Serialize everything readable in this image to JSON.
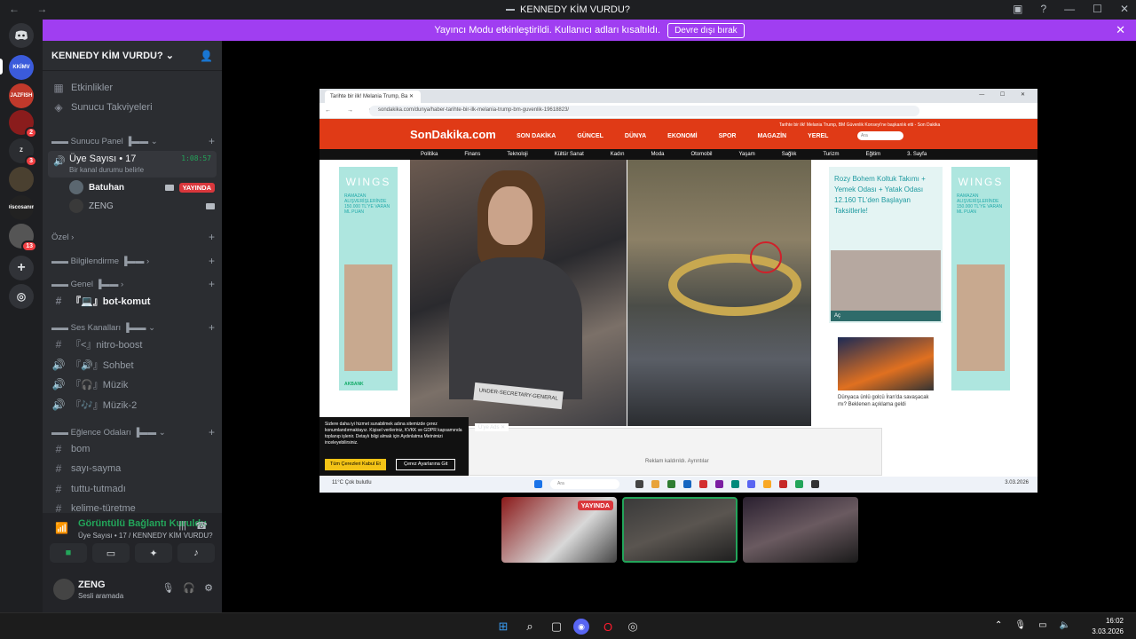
{
  "window": {
    "title": "KENNEDY KİM VURDU?"
  },
  "banner": {
    "message": "Yayıncı Modu etkinleştirildi. Kullanıcı adları kısaltıldı.",
    "button": "Devre dışı bırak"
  },
  "servers": [
    {
      "label": "KKİMV",
      "color": "#3b5bdb",
      "badge": ""
    },
    {
      "label": "JAZFISH",
      "color": "#c0392b",
      "badge": ""
    },
    {
      "label": "",
      "color": "#8a1c1c",
      "badge": "2"
    },
    {
      "label": "Z",
      "color": "#2b2d31",
      "badge": "3"
    },
    {
      "label": "",
      "color": "#4a4030",
      "badge": ""
    },
    {
      "label": "Discosanım",
      "color": "#222",
      "badge": ""
    },
    {
      "label": "",
      "color": "#555",
      "badge": "13"
    }
  ],
  "sidebar": {
    "server_name": "KENNEDY KİM VURDU?",
    "events": "Etkinlikler",
    "boosts": "Sunucu Takviyeleri",
    "cat_panel": "▬▬ Sunucu Panel ▐▬▬",
    "voice_channel": {
      "name": "Üye Sayısı • 17",
      "status": "Bir kanal durumu belirle",
      "timer": "1:08:57"
    },
    "voice_users": [
      {
        "name": "Batuhan",
        "live": "YAYINDA"
      },
      {
        "name": "ZENG",
        "live": ""
      }
    ],
    "cat_private": "Özel",
    "cat_info": "▬▬ Bilgilendirme ▐▬▬",
    "cat_general": "▬▬ Genel ▐▬▬",
    "general_channels": [
      {
        "name": "『💻』bot-komut",
        "icon": "#"
      }
    ],
    "cat_voice": "▬▬ Ses Kanalları ▐▬▬",
    "voice_channels": [
      {
        "name": "『<』nitro-boost",
        "icon": "#"
      },
      {
        "name": "『🔊』Sohbet",
        "icon": "🔊"
      },
      {
        "name": "『🎧』Müzik",
        "icon": "🔊"
      },
      {
        "name": "『🎶』Müzik-2",
        "icon": "🔊"
      }
    ],
    "cat_fun": "▬▬ Eğlence Odaları ▐▬▬",
    "fun_channels": [
      {
        "name": "bom",
        "icon": "#"
      },
      {
        "name": "sayı-sayma",
        "icon": "#"
      },
      {
        "name": "tuttu-tutmadı",
        "icon": "#"
      },
      {
        "name": "kelime-türetme",
        "icon": "#"
      }
    ]
  },
  "voice_panel": {
    "status": "Görüntülü Bağlantı Kuruldu",
    "sub": "Üye Sayısı • 17 / KENNEDY KİM VURDU?"
  },
  "user": {
    "name": "ZENG",
    "status": "Sesli aramada"
  },
  "stream": {
    "tab_title": "Tarihte bir ilk! Melania Trump, Ba",
    "url": "sondakika.com/dunya/haber-tarihte-bir-ilk-melania-trump-bm-guvenlik-19618823/",
    "logo": "SonDakika.com",
    "nav": [
      "SON DAKİKA",
      "GÜNCEL",
      "DÜNYA",
      "EKONOMİ",
      "SPOR",
      "MAGAZİN",
      "YEREL"
    ],
    "cats": [
      "Politika",
      "Finans",
      "Teknoloji",
      "Kültür Sanat",
      "Kadın",
      "Moda",
      "Otomobil",
      "Yaşam",
      "Sağlık",
      "Turizm",
      "Eğitim",
      "3. Sayfa"
    ],
    "note": "Tarihte bir ilk! Melania Trump, BM Güvenlik Konseyi'ne başkanlık etti - Son Dakika",
    "ad_side": {
      "brand": "WINGS",
      "text": "RAMAZAN ALIŞVERİŞLERİNDE 150.000 TL'YE VARAN ML PUAN",
      "bank": "AKBANK"
    },
    "ad_mid": {
      "text": "Rozy Bohem Koltuk Takımı + Yemek Odası + Yatak Odası 12.160 TL'den Başlayan Taksitlerle!",
      "cta": "Aç"
    },
    "plate": "UNDER-SECRETARY-GENERAL",
    "news": "Dünyaca ünlü golcü İran'da savaşacak mı? Beklenen açıklama geldi",
    "cookie": {
      "text": "Sizlere daha iyi hizmet sunabilmek adına sitemizde çerez konumlandırmaktayız. Kişisel verileriniz, KVKK ve GDPR kapsamında toplanıp işlenir. Detaylı bilgi almak için Aydınlatma Metnimizi inceleyebilirsiniz.",
      "accept": "Tüm Çerezleri Kabul Et",
      "settings": "Çerez Ayarlarına Git"
    },
    "ad_closed": "Reklam kaldırıldı. Ayrıntılar",
    "ad_label": "Ü'ye Ads",
    "search": "Ara",
    "weather": "11°C Çok bulutlu",
    "date": "3.03.2026"
  },
  "thumbs": [
    {
      "live": "YAYINDA"
    },
    {
      "live": ""
    },
    {
      "live": ""
    }
  ],
  "taskbar": {
    "time": "16:02",
    "date": "3.03.2026"
  }
}
